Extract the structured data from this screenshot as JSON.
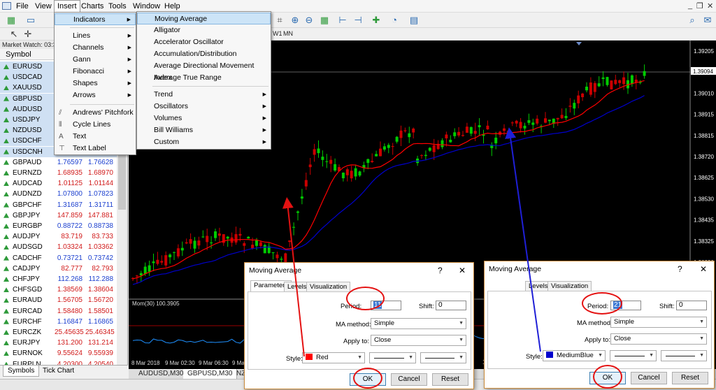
{
  "menubar": {
    "items": [
      "File",
      "View",
      "Insert",
      "Charts",
      "Tools",
      "Window",
      "Help"
    ]
  },
  "chart_tf": {
    "w1": "W1",
    "mn": "MN"
  },
  "market_watch": {
    "title": "Market Watch: 03:3",
    "col_symbol": "Symbol",
    "rows": [
      {
        "symbol": "EURUSD",
        "bid": "",
        "ask": "",
        "dir": "up"
      },
      {
        "symbol": "USDCAD",
        "bid": "",
        "ask": "",
        "dir": "up"
      },
      {
        "symbol": "XAUUSD",
        "bid": "",
        "ask": "",
        "dir": "up"
      },
      {
        "symbol": "GBPUSD",
        "bid": "",
        "ask": "",
        "dir": "up"
      },
      {
        "symbol": "AUDUSD",
        "bid": "",
        "ask": "",
        "dir": "up"
      },
      {
        "symbol": "USDJPY",
        "bid": "",
        "ask": "",
        "dir": "up"
      },
      {
        "symbol": "NZDUSD",
        "bid": "",
        "ask": "",
        "dir": "up"
      },
      {
        "symbol": "USDCHF",
        "bid": "",
        "ask": "",
        "dir": "up"
      },
      {
        "symbol": "USDCNH",
        "bid": "",
        "ask": "",
        "dir": "up"
      },
      {
        "symbol": "GBPAUD",
        "bid": "1.76597",
        "ask": "1.76628",
        "dir": "up",
        "color": "blue"
      },
      {
        "symbol": "EURNZD",
        "bid": "1.68935",
        "ask": "1.68970",
        "dir": "up",
        "color": "red"
      },
      {
        "symbol": "AUDCAD",
        "bid": "1.01125",
        "ask": "1.01144",
        "dir": "up",
        "color": "red"
      },
      {
        "symbol": "AUDNZD",
        "bid": "1.07800",
        "ask": "1.07823",
        "dir": "up",
        "color": "blue"
      },
      {
        "symbol": "GBPCHF",
        "bid": "1.31687",
        "ask": "1.31711",
        "dir": "up",
        "color": "blue"
      },
      {
        "symbol": "GBPJPY",
        "bid": "147.859",
        "ask": "147.881",
        "dir": "up",
        "color": "red"
      },
      {
        "symbol": "EURGBP",
        "bid": "0.88722",
        "ask": "0.88738",
        "dir": "up",
        "color": "blue"
      },
      {
        "symbol": "AUDJPY",
        "bid": "83.719",
        "ask": "83.733",
        "dir": "up",
        "color": "red"
      },
      {
        "symbol": "AUDSGD",
        "bid": "1.03324",
        "ask": "1.03362",
        "dir": "up",
        "color": "red"
      },
      {
        "symbol": "CADCHF",
        "bid": "0.73721",
        "ask": "0.73742",
        "dir": "up",
        "color": "blue"
      },
      {
        "symbol": "CADJPY",
        "bid": "82.777",
        "ask": "82.793",
        "dir": "up",
        "color": "red"
      },
      {
        "symbol": "CHFJPY",
        "bid": "112.268",
        "ask": "112.288",
        "dir": "up",
        "color": "blue"
      },
      {
        "symbol": "CHFSGD",
        "bid": "1.38569",
        "ask": "1.38604",
        "dir": "up",
        "color": "red"
      },
      {
        "symbol": "EURAUD",
        "bid": "1.56705",
        "ask": "1.56720",
        "dir": "up",
        "color": "red"
      },
      {
        "symbol": "EURCAD",
        "bid": "1.58480",
        "ask": "1.58501",
        "dir": "up",
        "color": "red"
      },
      {
        "symbol": "EURCHF",
        "bid": "1.16847",
        "ask": "1.16865",
        "dir": "up",
        "color": "blue"
      },
      {
        "symbol": "EURCZK",
        "bid": "25.45635",
        "ask": "25.46345",
        "dir": "up",
        "color": "red"
      },
      {
        "symbol": "EURJPY",
        "bid": "131.200",
        "ask": "131.214",
        "dir": "up",
        "color": "red"
      },
      {
        "symbol": "EURNOK",
        "bid": "9.55624",
        "ask": "9.55939",
        "dir": "up",
        "color": "red"
      },
      {
        "symbol": "EURPLN",
        "bid": "4.20300",
        "ask": "4.20540",
        "dir": "up",
        "color": "red"
      }
    ],
    "tabs": [
      "Symbols",
      "Tick Chart"
    ]
  },
  "insert_menu": {
    "items": [
      "Indicators",
      "Lines",
      "Channels",
      "Gann",
      "Fibonacci",
      "Shapes",
      "Arrows",
      "Andrews' Pitchfork",
      "Cycle Lines",
      "Text",
      "Text Label"
    ]
  },
  "indicators_menu": {
    "items": [
      "Moving Average",
      "Alligator",
      "Accelerator Oscillator",
      "Accumulation/Distribution",
      "Average Directional Movement Index",
      "Average True Range",
      "Trend",
      "Oscillators",
      "Volumes",
      "Bill Williams",
      "Custom"
    ]
  },
  "chart": {
    "price_labels": [
      "1.39205",
      "1.39094",
      "1.39010",
      "1.38915",
      "1.38815",
      "1.38720",
      "1.38625",
      "1.38530",
      "1.38435",
      "1.38325",
      "1.38230",
      "1.38140"
    ],
    "current_price": "1.39094",
    "indicator_label": "Mom(30) 100.3905",
    "time_labels": [
      "8 Mar 2018",
      "9 Mar 02:30",
      "9 Mar 06:30",
      "9 Mar 10:"
    ],
    "tabs": [
      "AUDUSD,M30",
      "GBPUSD,M30",
      "NZ"
    ],
    "tf_peek": "1s",
    "bull_color": "#00cc00",
    "bear_color": "#cc0000",
    "ma_fast_color": "#ff0000",
    "ma_slow_color": "#0000cd"
  },
  "dialog_left": {
    "title": "Moving Average",
    "help": "?",
    "close": "✕",
    "tabs": [
      "Parameters",
      "Levels",
      "Visualization"
    ],
    "period_label": "Period:",
    "period_value": "11",
    "shift_label": "Shift:",
    "shift_value": "0",
    "method_label": "MA method:",
    "method_value": "Simple",
    "apply_label": "Apply to:",
    "apply_value": "Close",
    "style_label": "Style:",
    "style_color_name": "Red",
    "style_color": "#ff0000",
    "ok": "OK",
    "cancel": "Cancel",
    "reset": "Reset"
  },
  "dialog_right": {
    "title": "Moving Average",
    "help": "?",
    "close": "✕",
    "tabs": [
      "Levels",
      "Visualization"
    ],
    "period_label": "Period:",
    "period_value": "21",
    "shift_label": "Shift:",
    "shift_value": "0",
    "method_label": "MA method:",
    "method_value": "Simple",
    "apply_label": "Apply to:",
    "apply_value": "Close",
    "style_label": "Style:",
    "style_color_name": "MediumBlue",
    "style_color": "#0000cd",
    "ok": "OK",
    "cancel": "Cancel",
    "reset": "Reset"
  }
}
